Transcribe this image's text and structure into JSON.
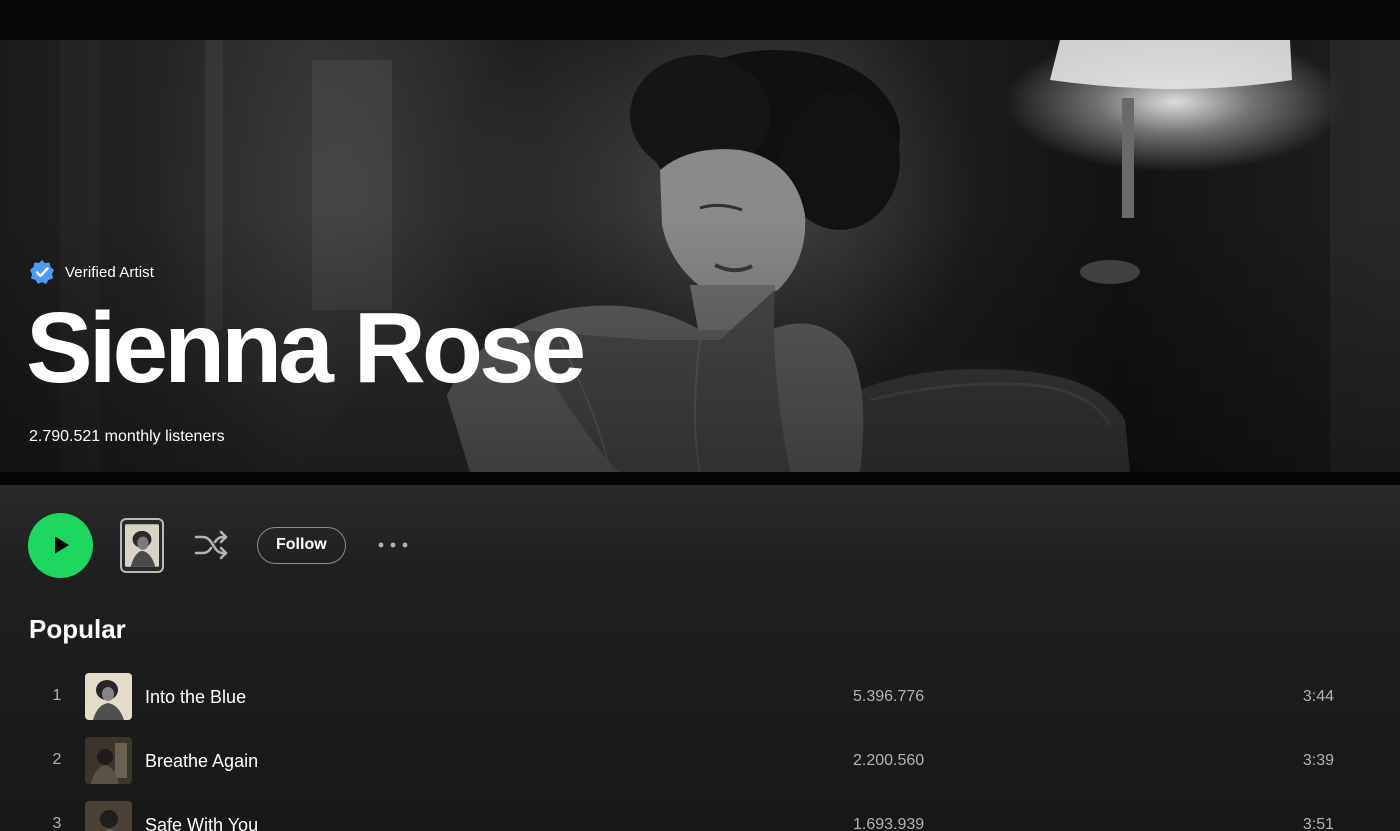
{
  "artist": {
    "verified_label": "Verified Artist",
    "name": "Sienna Rose",
    "monthly_listeners": "2.790.521 monthly listeners"
  },
  "actions": {
    "follow_label": "Follow"
  },
  "popular": {
    "title": "Popular",
    "tracks": [
      {
        "index": "1",
        "title": "Into the Blue",
        "plays": "5.396.776",
        "duration": "3:44"
      },
      {
        "index": "2",
        "title": "Breathe Again",
        "plays": "2.200.560",
        "duration": "3:39"
      },
      {
        "index": "3",
        "title": "Safe With You",
        "plays": "1.693.939",
        "duration": "3:51"
      }
    ]
  },
  "icons": {
    "play": "play-icon",
    "shuffle": "shuffle-icon",
    "more": "more-options-icon",
    "verified": "verified-badge-icon"
  },
  "colors": {
    "accent_green": "#1ed760",
    "verified_blue": "#4c9cf5",
    "background": "#121212",
    "muted_text": "#b3b3b3"
  }
}
